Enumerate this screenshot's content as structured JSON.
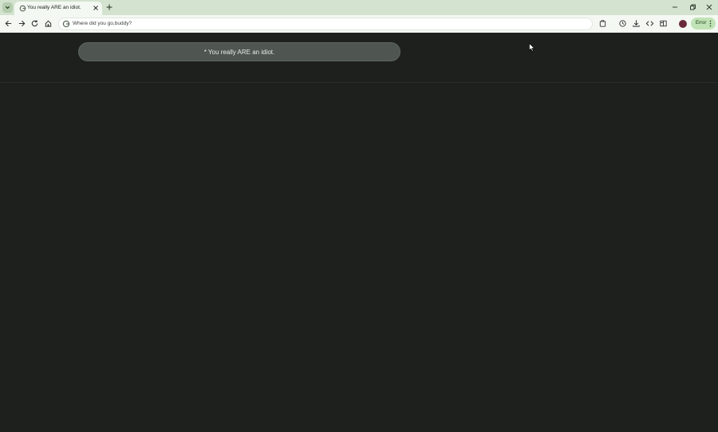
{
  "tab": {
    "title": "You really ARE an idiot."
  },
  "omnibox": {
    "value": "Where did you go,buddy?"
  },
  "profile": {
    "chip_label": "Error"
  },
  "page": {
    "message": "* You really ARE an idiot."
  },
  "icons": [
    "tab-search-icon",
    "google-icon",
    "close-icon",
    "plus-icon",
    "minimize-icon",
    "restore-icon",
    "back-icon",
    "forward-icon",
    "reload-icon",
    "home-icon",
    "extensions-icon",
    "history-icon",
    "download-icon",
    "code-icon",
    "sidepanel-icon",
    "kebab-menu-icon",
    "mouse-cursor-icon"
  ],
  "colors": {
    "tabstrip": "#d3e3cf",
    "toolbar": "#f4f8f2",
    "page_bg": "#1e201e",
    "banner_bg": "#4f5652",
    "error_chip": "#bfe3b6"
  }
}
